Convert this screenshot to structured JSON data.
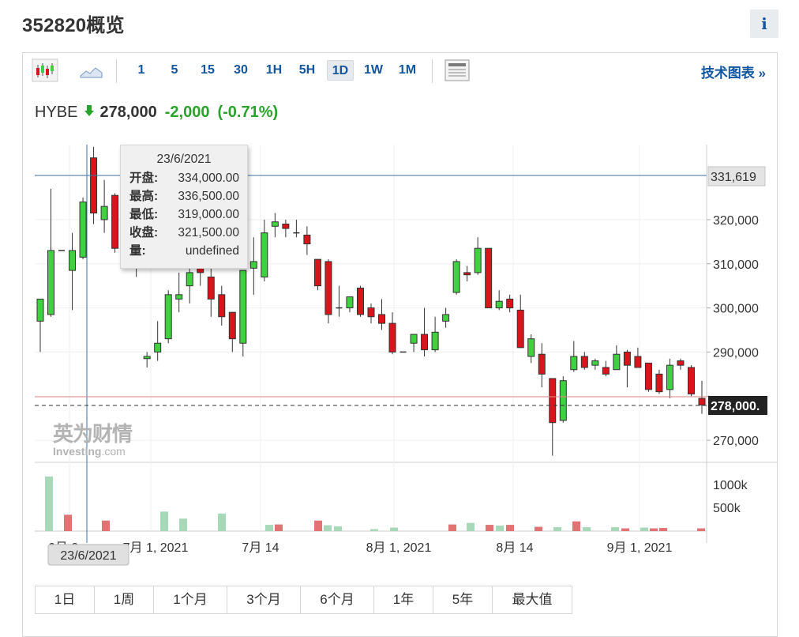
{
  "title": "352820概览",
  "info_label": "i",
  "toolbar": {
    "intervals": [
      "1",
      "5",
      "15",
      "30",
      "1H",
      "5H",
      "1D",
      "1W",
      "1M"
    ],
    "active_interval": "1D",
    "tech_link": "技术图表 »"
  },
  "quote": {
    "symbol": "HYBE",
    "price": "278,000",
    "change": "-2,000",
    "change_pct": "(-0.71%)"
  },
  "tooltip": {
    "date": "23/6/2021",
    "rows": [
      {
        "label": "开盘:",
        "value": "334,000.00"
      },
      {
        "label": "最高:",
        "value": "336,500.00"
      },
      {
        "label": "最低:",
        "value": "319,000.00"
      },
      {
        "label": "收盘:",
        "value": "321,500.00"
      },
      {
        "label": "量:",
        "value": "undefined"
      }
    ]
  },
  "crosshair": {
    "date_label": "23/6/2021",
    "price_label": "331,619"
  },
  "last_price_label": "278,000.",
  "watermark": {
    "cn": "英为财情",
    "en": "Investing",
    "com": ".com"
  },
  "ranges": [
    "1日",
    "1周",
    "1个月",
    "3个月",
    "6个月",
    "1年",
    "5年",
    "最大值"
  ],
  "colors": {
    "up": "#3fd13f",
    "down": "#d9141b",
    "vol_up": "#a7d8b7",
    "vol_down": "#e17373",
    "link": "#1256a0",
    "change": "#29a329"
  },
  "chart_data": {
    "type": "candlestick",
    "price_ticks": [
      270000,
      280000,
      290000,
      300000,
      310000,
      320000
    ],
    "price_tick_labels": [
      "270,000",
      "",
      "290,000",
      "300,000",
      "310,000",
      "320,000"
    ],
    "volume_tick_labels": [
      "1000k",
      "500k"
    ],
    "x_labels": [
      "6月 2",
      "7月 1, 2021",
      "7月 14",
      "8月 1, 2021",
      "8月 14",
      "9月 1, 2021"
    ],
    "ylim": [
      265000,
      337000
    ],
    "candles": [
      {
        "o": 297000,
        "h": 301000,
        "l": 290000,
        "c": 302000
      },
      {
        "o": 298500,
        "h": 327000,
        "l": 298000,
        "c": 313000
      },
      {
        "o": 313000,
        "h": 313000,
        "l": 313000,
        "c": 313000
      },
      {
        "o": 308500,
        "h": 317000,
        "l": 299500,
        "c": 313000
      },
      {
        "o": 311500,
        "h": 325000,
        "l": 311000,
        "c": 324000
      },
      {
        "o": 334000,
        "h": 336500,
        "l": 319000,
        "c": 321500
      },
      {
        "o": 320000,
        "h": 329000,
        "l": 317000,
        "c": 323000
      },
      {
        "o": 325500,
        "h": 326000,
        "l": 312500,
        "c": 313500
      },
      {
        "o": 314000,
        "h": 314000,
        "l": 314000,
        "c": 314000
      },
      {
        "o": 314000,
        "h": 314000,
        "l": 307000,
        "c": 314000
      },
      {
        "o": 288500,
        "h": 290000,
        "l": 286500,
        "c": 289000
      },
      {
        "o": 290000,
        "h": 297000,
        "l": 288000,
        "c": 292000
      },
      {
        "o": 293000,
        "h": 304000,
        "l": 292000,
        "c": 303000
      },
      {
        "o": 302000,
        "h": 308000,
        "l": 299000,
        "c": 303000
      },
      {
        "o": 305000,
        "h": 310000,
        "l": 301000,
        "c": 308000
      },
      {
        "o": 309000,
        "h": 313000,
        "l": 305000,
        "c": 308000
      },
      {
        "o": 307000,
        "h": 310000,
        "l": 298000,
        "c": 302000
      },
      {
        "o": 303000,
        "h": 305000,
        "l": 296000,
        "c": 298000
      },
      {
        "o": 299000,
        "h": 299000,
        "l": 290000,
        "c": 293000
      },
      {
        "o": 292000,
        "h": 308000,
        "l": 289000,
        "c": 308500
      },
      {
        "o": 309000,
        "h": 316000,
        "l": 303000,
        "c": 310500
      },
      {
        "o": 307000,
        "h": 320000,
        "l": 306000,
        "c": 317000
      },
      {
        "o": 318500,
        "h": 321500,
        "l": 316000,
        "c": 319500
      },
      {
        "o": 319000,
        "h": 320000,
        "l": 316000,
        "c": 318000
      },
      {
        "o": 317000,
        "h": 320000,
        "l": 316000,
        "c": 317000
      },
      {
        "o": 316500,
        "h": 318500,
        "l": 312000,
        "c": 314500
      },
      {
        "o": 311000,
        "h": 311000,
        "l": 304000,
        "c": 305000
      },
      {
        "o": 310500,
        "h": 311000,
        "l": 296500,
        "c": 298500
      },
      {
        "o": 300000,
        "h": 305000,
        "l": 298000,
        "c": 300000
      },
      {
        "o": 300000,
        "h": 302500,
        "l": 299000,
        "c": 302500
      },
      {
        "o": 304500,
        "h": 305000,
        "l": 298000,
        "c": 298500
      },
      {
        "o": 300000,
        "h": 301000,
        "l": 296500,
        "c": 298000
      },
      {
        "o": 298500,
        "h": 302000,
        "l": 295000,
        "c": 296500
      },
      {
        "o": 296500,
        "h": 299000,
        "l": 289500,
        "c": 290000
      },
      {
        "o": 290000,
        "h": 290000,
        "l": 290000,
        "c": 290000
      },
      {
        "o": 292000,
        "h": 294000,
        "l": 290000,
        "c": 294000
      },
      {
        "o": 294000,
        "h": 300000,
        "l": 289000,
        "c": 290500
      },
      {
        "o": 290500,
        "h": 298000,
        "l": 290000,
        "c": 294500
      },
      {
        "o": 297000,
        "h": 300000,
        "l": 295500,
        "c": 298500
      },
      {
        "o": 303500,
        "h": 311000,
        "l": 303000,
        "c": 310500
      },
      {
        "o": 308000,
        "h": 309500,
        "l": 306000,
        "c": 307500
      },
      {
        "o": 308000,
        "h": 316000,
        "l": 307500,
        "c": 313500
      },
      {
        "o": 313500,
        "h": 313500,
        "l": 300000,
        "c": 300000
      },
      {
        "o": 300000,
        "h": 304000,
        "l": 299500,
        "c": 301500
      },
      {
        "o": 302000,
        "h": 303000,
        "l": 299000,
        "c": 300000
      },
      {
        "o": 299500,
        "h": 303000,
        "l": 292000,
        "c": 291000
      },
      {
        "o": 289000,
        "h": 294000,
        "l": 287500,
        "c": 293000
      },
      {
        "o": 289500,
        "h": 292000,
        "l": 282000,
        "c": 285000
      },
      {
        "o": 284000,
        "h": 284000,
        "l": 266500,
        "c": 274000
      },
      {
        "o": 274500,
        "h": 284500,
        "l": 274000,
        "c": 283500
      },
      {
        "o": 286000,
        "h": 292500,
        "l": 285500,
        "c": 289000
      },
      {
        "o": 289000,
        "h": 290000,
        "l": 286000,
        "c": 286500
      },
      {
        "o": 287000,
        "h": 288500,
        "l": 286000,
        "c": 288000
      },
      {
        "o": 286500,
        "h": 288000,
        "l": 284500,
        "c": 285000
      },
      {
        "o": 286000,
        "h": 291500,
        "l": 286000,
        "c": 289500
      },
      {
        "o": 290000,
        "h": 290500,
        "l": 282000,
        "c": 287000
      },
      {
        "o": 289000,
        "h": 291000,
        "l": 286500,
        "c": 286500
      },
      {
        "o": 287500,
        "h": 287500,
        "l": 281000,
        "c": 281500
      },
      {
        "o": 285000,
        "h": 286000,
        "l": 280500,
        "c": 281000
      },
      {
        "o": 281500,
        "h": 288500,
        "l": 279500,
        "c": 287000
      },
      {
        "o": 288000,
        "h": 288500,
        "l": 286000,
        "c": 287000
      },
      {
        "o": 286500,
        "h": 287000,
        "l": 280000,
        "c": 280500
      },
      {
        "o": 279500,
        "h": 283500,
        "l": 276000,
        "c": 278000
      }
    ],
    "volume": [
      {
        "v": 1400,
        "up": true
      },
      {
        "v": 420,
        "up": false
      },
      {
        "v": 270,
        "up": false
      },
      {
        "v": 500,
        "up": true
      },
      {
        "v": 320,
        "up": true
      },
      {
        "v": 450,
        "up": true
      },
      {
        "v": 160,
        "up": true
      },
      {
        "v": 170,
        "up": false
      },
      {
        "v": 270,
        "up": false
      },
      {
        "v": 150,
        "up": true
      },
      {
        "v": 120,
        "up": true
      },
      {
        "v": 50,
        "up": true
      },
      {
        "v": 90,
        "up": true
      },
      {
        "v": 170,
        "up": false
      },
      {
        "v": 210,
        "up": true
      },
      {
        "v": 160,
        "up": false
      },
      {
        "v": 140,
        "up": true
      },
      {
        "v": 160,
        "up": false
      },
      {
        "v": 110,
        "up": false
      },
      {
        "v": 100,
        "up": true
      },
      {
        "v": 250,
        "up": false
      },
      {
        "v": 100,
        "up": true
      },
      {
        "v": 100,
        "up": true
      },
      {
        "v": 70,
        "up": false
      },
      {
        "v": 90,
        "up": true
      },
      {
        "v": 70,
        "up": false
      },
      {
        "v": 80,
        "up": false
      },
      {
        "v": 70,
        "up": false
      },
      {
        "v": 110,
        "up": false
      }
    ]
  }
}
